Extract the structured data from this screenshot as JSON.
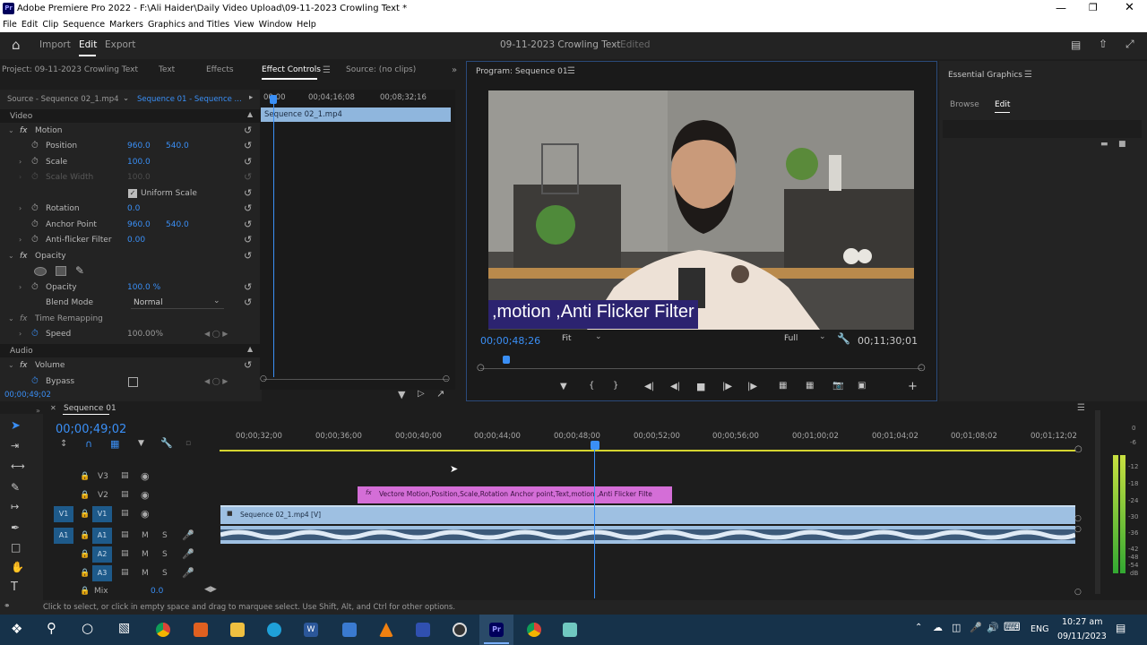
{
  "window": {
    "title": "Adobe Premiere Pro 2022 - F:\\Ali Haider\\Daily Video Upload\\09-11-2023 Crowling Text *",
    "app_icon": "Pr"
  },
  "menu": [
    "File",
    "Edit",
    "Clip",
    "Sequence",
    "Markers",
    "Graphics and Titles",
    "View",
    "Window",
    "Help"
  ],
  "workspace": {
    "tabs": [
      "Import",
      "Edit",
      "Export"
    ],
    "active": "Edit",
    "project_title": "09-11-2023 Crowling Text",
    "edited": "- Edited"
  },
  "left_tabs": [
    "Project: 09-11-2023 Crowling Text",
    "Text",
    "Effects",
    "Effect Controls",
    "Source: (no clips)"
  ],
  "effect_controls": {
    "source": "Source - Sequence 02_1.mp4",
    "sequence": "Sequence 01 - Sequence ...",
    "ruler": [
      "00;00",
      "00;04;16;08",
      "00;08;32;16"
    ],
    "clip": "Sequence 02_1.mp4",
    "video_label": "Video",
    "motion": "Motion",
    "position": {
      "label": "Position",
      "x": "960.0",
      "y": "540.0"
    },
    "scale": {
      "label": "Scale",
      "v": "100.0"
    },
    "scale_width": {
      "label": "Scale Width",
      "v": "100.0"
    },
    "uniform": "Uniform Scale",
    "rotation": {
      "label": "Rotation",
      "v": "0.0"
    },
    "anchor": {
      "label": "Anchor Point",
      "x": "960.0",
      "y": "540.0"
    },
    "antiflicker": {
      "label": "Anti-flicker Filter",
      "v": "0.00"
    },
    "opacity_fx": "Opacity",
    "opacity": {
      "label": "Opacity",
      "v": "100.0 %"
    },
    "blend": {
      "label": "Blend Mode",
      "v": "Normal"
    },
    "time_remap": "Time Remapping",
    "speed": {
      "label": "Speed",
      "v": "100.00%"
    },
    "audio_label": "Audio",
    "volume": "Volume",
    "bypass": {
      "label": "Bypass"
    },
    "timecode": "00;00;49;02"
  },
  "program": {
    "title": "Program: Sequence 01",
    "caption": ",motion ,Anti Flicker Filter",
    "timecode": "00;00;48;26",
    "fit": "Fit",
    "full": "Full",
    "duration": "00;11;30;01"
  },
  "essential": {
    "title": "Essential Graphics",
    "tabs": [
      "Browse",
      "Edit"
    ],
    "active": "Edit"
  },
  "timeline": {
    "seq_tab": "Sequence 01",
    "timecode": "00;00;49;02",
    "ruler": [
      "00;00;32;00",
      "00;00;36;00",
      "00;00;40;00",
      "00;00;44;00",
      "00;00;48;00",
      "00;00;52;00",
      "00;00;56;00",
      "00;01;00;02",
      "00;01;04;02",
      "00;01;08;02",
      "00;01;12;02"
    ],
    "tracks": [
      {
        "src": "",
        "name": "V3"
      },
      {
        "src": "",
        "name": "V2"
      },
      {
        "src": "V1",
        "name": "V1"
      },
      {
        "src": "A1",
        "name": "A1"
      },
      {
        "src": "",
        "name": "A2"
      },
      {
        "src": "",
        "name": "A3"
      }
    ],
    "mix": {
      "label": "Mix",
      "v": "0.0"
    },
    "graphic_clip": "Vectore Motion,Position,Scale,Rotation Anchor point,Text,motion ,Anti Flicker Filte",
    "video_clip": "Sequence 02_1.mp4 [V]",
    "track_buttons": {
      "mute": "M",
      "solo": "S"
    },
    "meter": [
      "0",
      "-6",
      "-12",
      "-18",
      "-24",
      "-30",
      "-36",
      "-42",
      "-48",
      "-54",
      "dB"
    ]
  },
  "status": "Click to select, or click in empty space and drag to marquee select. Use Shift, Alt, and Ctrl for other options.",
  "taskbar": {
    "lang": "ENG",
    "time": "10:27 am",
    "date": "09/11/2023"
  }
}
